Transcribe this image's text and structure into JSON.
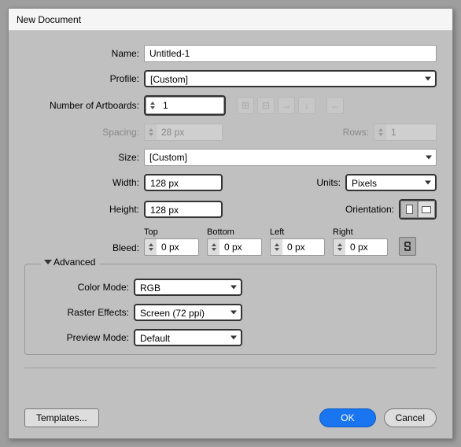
{
  "title": "New Document",
  "labels": {
    "name": "Name:",
    "profile": "Profile:",
    "numArtboards": "Number of Artboards:",
    "spacing": "Spacing:",
    "rows": "Rows:",
    "size": "Size:",
    "width": "Width:",
    "units": "Units:",
    "height": "Height:",
    "orientation": "Orientation:",
    "bleed": "Bleed:",
    "top": "Top",
    "bottom": "Bottom",
    "left": "Left",
    "right": "Right",
    "advanced": "Advanced",
    "colorMode": "Color Mode:",
    "rasterEffects": "Raster Effects:",
    "previewMode": "Preview Mode:"
  },
  "values": {
    "name": "Untitled-1",
    "profile": "[Custom]",
    "numArtboards": "1",
    "spacing": "28 px",
    "rows": "1",
    "size": "[Custom]",
    "width": "128 px",
    "height": "128 px",
    "units": "Pixels",
    "bleedTop": "0 px",
    "bleedBottom": "0 px",
    "bleedLeft": "0 px",
    "bleedRight": "0 px",
    "colorMode": "RGB",
    "rasterEffects": "Screen (72 ppi)",
    "previewMode": "Default"
  },
  "buttons": {
    "templates": "Templates...",
    "ok": "OK",
    "cancel": "Cancel"
  }
}
